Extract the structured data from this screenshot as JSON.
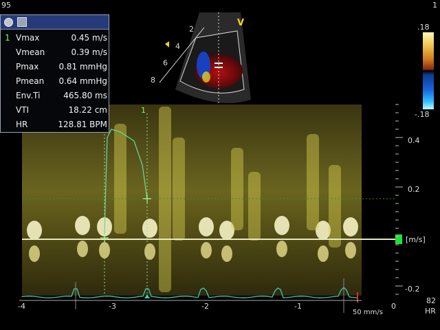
{
  "corners": {
    "top_left": "95",
    "top_right": "1"
  },
  "measurements": {
    "index": "1",
    "rows": [
      {
        "label": "Vmax",
        "value": "0.45 m/s"
      },
      {
        "label": "Vmean",
        "value": "0.39 m/s"
      },
      {
        "label": "Pmax",
        "value": "0.81 mmHg"
      },
      {
        "label": "Pmean",
        "value": "0.64 mmHg"
      },
      {
        "label": "Env.Ti",
        "value": "465.80 ms"
      },
      {
        "label": "VTI",
        "value": "18.22 cm"
      },
      {
        "label": "HR",
        "value": "128.81 BPM"
      }
    ]
  },
  "sector": {
    "mode_marker": "V",
    "depth_ticks": [
      "2",
      "4",
      "6",
      "8"
    ]
  },
  "color_scale": {
    "top": ".18",
    "bottom": "-.18"
  },
  "velocity_scale": {
    "ticks": [
      "0.4",
      "0.2",
      "-0.2"
    ],
    "unit": "[m/s]"
  },
  "time_axis": {
    "ticks": [
      "-4",
      "-3",
      "-2",
      "-1",
      "0"
    ],
    "sweep_speed": "50 mm/s"
  },
  "hr_readout": {
    "value": "82",
    "label": "HR"
  },
  "cursor_label": "1",
  "colors": {
    "spectrum": "#c8bf3a",
    "envelope": "#5fe0a0",
    "ecg": "#3fc7b8",
    "baseline_marker": "#22e03a",
    "panel_header": "#243a7a"
  }
}
